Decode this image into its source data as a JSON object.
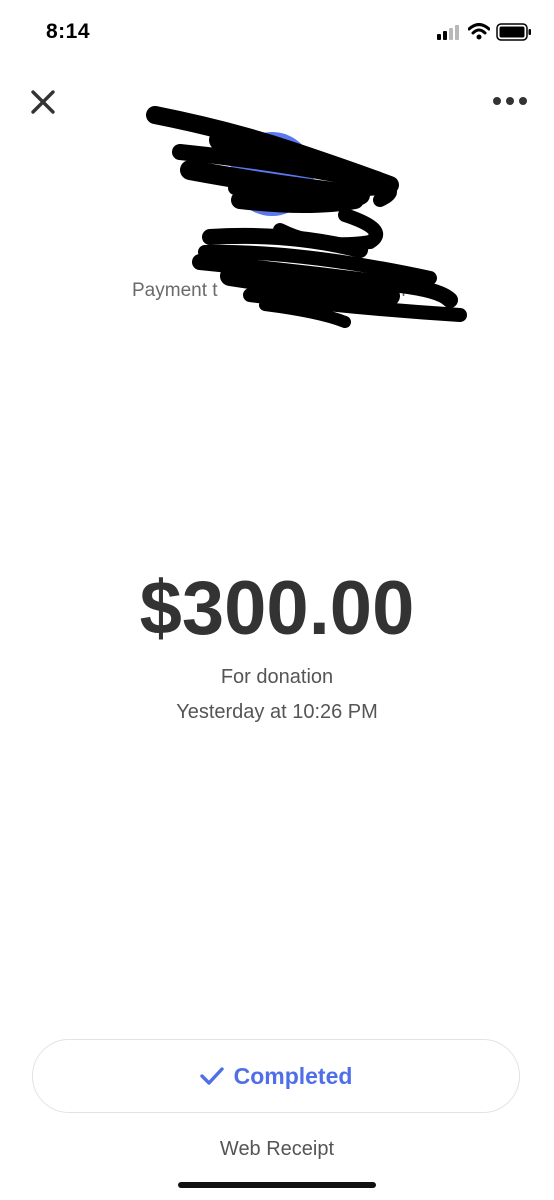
{
  "status_bar": {
    "time": "8:14",
    "signal_icon": "cellular-signal-icon",
    "wifi_icon": "wifi-icon",
    "battery_icon": "battery-icon"
  },
  "header": {
    "close_icon": "close-icon",
    "more_icon": "more-options-icon"
  },
  "recipient": {
    "avatar_color": "#5b78ee",
    "payment_label": "Payment t",
    "label_tail": "54",
    "redacted": true
  },
  "transaction": {
    "amount": "$300.00",
    "note": "For donation",
    "timestamp": "Yesterday at 10:26 PM"
  },
  "status": {
    "label": "Completed",
    "icon": "checkmark-icon",
    "accent_color": "#4f6fe8"
  },
  "footer": {
    "web_receipt_label": "Web Receipt"
  }
}
